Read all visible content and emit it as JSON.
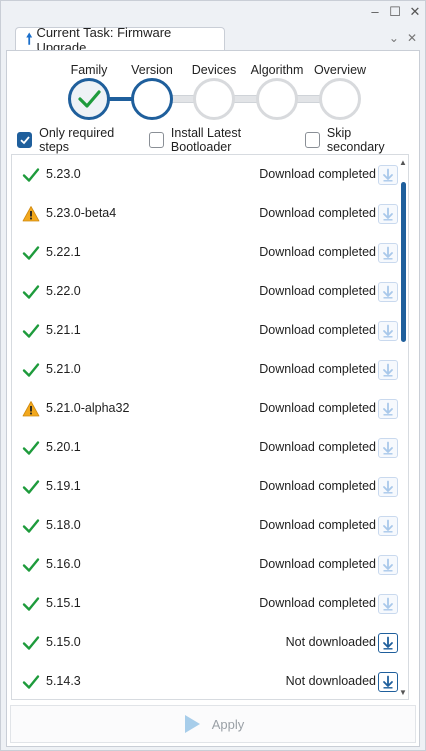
{
  "window": {
    "controls": [
      "–",
      "☐",
      "✕"
    ]
  },
  "tab": {
    "title": "Current Task: Firmware Upgrade",
    "controls": [
      "⌄",
      "✕"
    ]
  },
  "steps": [
    {
      "label": "Family",
      "state": "done"
    },
    {
      "label": "Version",
      "state": "current"
    },
    {
      "label": "Devices",
      "state": "pending"
    },
    {
      "label": "Algorithm",
      "state": "pending"
    },
    {
      "label": "Overview",
      "state": "pending"
    }
  ],
  "options": {
    "only_required": {
      "label": "Only required steps",
      "checked": true
    },
    "latest_bootloader": {
      "label": "Install Latest Bootloader",
      "checked": false
    },
    "skip_secondary": {
      "label": "Skip secondary",
      "checked": false
    }
  },
  "versions": [
    {
      "version": "5.23.0",
      "icon": "check-icon",
      "status": "Download completed",
      "downloaded": true
    },
    {
      "version": "5.23.0-beta4",
      "icon": "warning-icon",
      "status": "Download completed",
      "downloaded": true
    },
    {
      "version": "5.22.1",
      "icon": "check-icon",
      "status": "Download completed",
      "downloaded": true
    },
    {
      "version": "5.22.0",
      "icon": "check-icon",
      "status": "Download completed",
      "downloaded": true
    },
    {
      "version": "5.21.1",
      "icon": "check-icon",
      "status": "Download completed",
      "downloaded": true
    },
    {
      "version": "5.21.0",
      "icon": "check-icon",
      "status": "Download completed",
      "downloaded": true
    },
    {
      "version": "5.21.0-alpha32",
      "icon": "warning-icon",
      "status": "Download completed",
      "downloaded": true
    },
    {
      "version": "5.20.1",
      "icon": "check-icon",
      "status": "Download completed",
      "downloaded": true
    },
    {
      "version": "5.19.1",
      "icon": "check-icon",
      "status": "Download completed",
      "downloaded": true
    },
    {
      "version": "5.18.0",
      "icon": "check-icon",
      "status": "Download completed",
      "downloaded": true
    },
    {
      "version": "5.16.0",
      "icon": "check-icon",
      "status": "Download completed",
      "downloaded": true
    },
    {
      "version": "5.15.1",
      "icon": "check-icon",
      "status": "Download completed",
      "downloaded": true
    },
    {
      "version": "5.15.0",
      "icon": "check-icon",
      "status": "Not downloaded",
      "downloaded": false
    },
    {
      "version": "5.14.3",
      "icon": "check-icon",
      "status": "Not downloaded",
      "downloaded": false
    }
  ],
  "apply": {
    "label": "Apply",
    "enabled": false
  },
  "colors": {
    "accent": "#1f5f9c",
    "check": "#1e9b3c",
    "warning": "#f2a81d"
  }
}
